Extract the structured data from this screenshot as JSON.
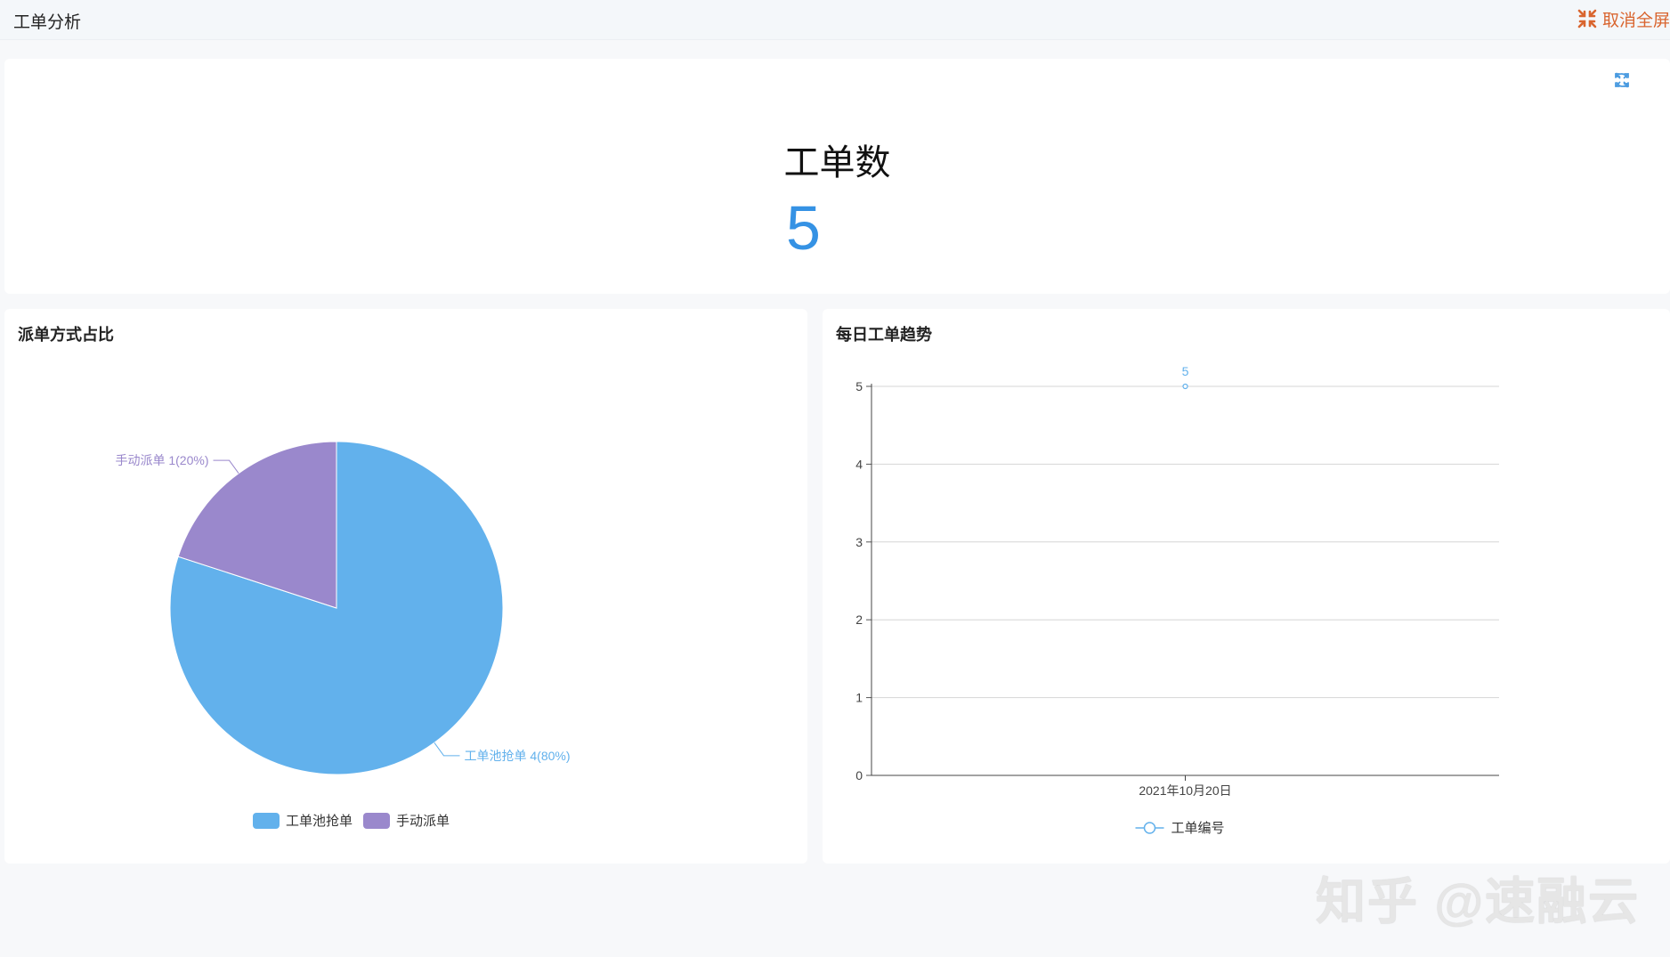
{
  "header": {
    "title": "工单分析",
    "exit_fullscreen_label": "取消全屏"
  },
  "kpi": {
    "label": "工单数",
    "value": "5"
  },
  "pie_card": {
    "title": "派单方式占比"
  },
  "line_card": {
    "title": "每日工单趋势"
  },
  "watermark": "知乎 @速融云",
  "colors": {
    "blue": "#62b1ec",
    "purple": "#9a88cc",
    "accent": "#3592e4",
    "orange": "#d9652f"
  },
  "chart_data": [
    {
      "type": "pie",
      "title": "派单方式占比",
      "series": [
        {
          "name": "工单池抢单",
          "value": 4,
          "label": "工单池抢单 4(80%)",
          "color": "#62b1ec"
        },
        {
          "name": "手动派单",
          "value": 1,
          "label": "手动派单 1(20%)",
          "color": "#9a88cc"
        }
      ],
      "legend": "bottom-center"
    },
    {
      "type": "line",
      "title": "每日工单趋势",
      "categories": [
        "2021年10月20日"
      ],
      "series": [
        {
          "name": "工单编号",
          "values": [
            5
          ],
          "color": "#62b1ec"
        }
      ],
      "ylim": [
        0,
        5
      ],
      "yticks": [
        0,
        1,
        2,
        3,
        4,
        5
      ],
      "grid": true,
      "legend": "bottom-center"
    }
  ]
}
